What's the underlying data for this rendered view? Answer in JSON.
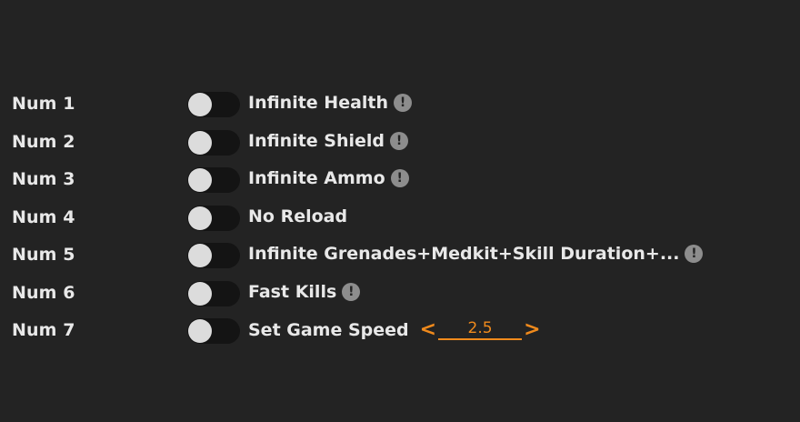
{
  "options": [
    {
      "key": "Num 1",
      "label": "Infinite Health",
      "enabled": false,
      "info": true
    },
    {
      "key": "Num 2",
      "label": "Infinite Shield",
      "enabled": false,
      "info": true
    },
    {
      "key": "Num 3",
      "label": "Infinite Ammo",
      "enabled": false,
      "info": true
    },
    {
      "key": "Num 4",
      "label": "No Reload",
      "enabled": false,
      "info": false
    },
    {
      "key": "Num 5",
      "label": "Infinite Grenades+Medkit+Skill Duration+...",
      "enabled": false,
      "info": true
    },
    {
      "key": "Num 6",
      "label": "Fast Kills",
      "enabled": false,
      "info": true
    },
    {
      "key": "Num 7",
      "label": "Set Game Speed",
      "enabled": false,
      "info": false
    }
  ],
  "speed": {
    "decrease": "<",
    "value": "2.5",
    "increase": ">"
  },
  "info_icon_glyph": "!",
  "colors": {
    "background": "#232323",
    "accent": "#f08a1c",
    "text": "#e8e8e8"
  }
}
